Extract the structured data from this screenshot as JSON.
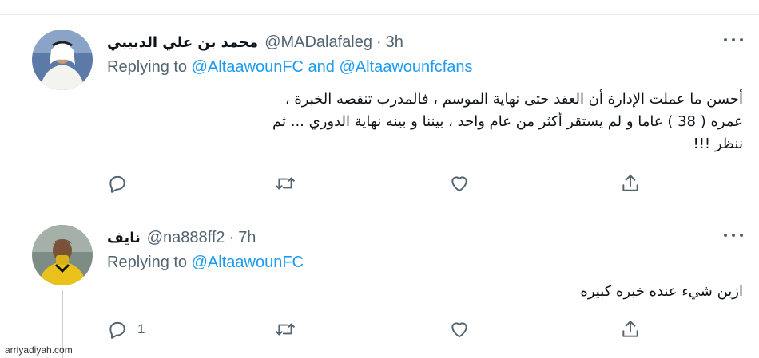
{
  "tweets": [
    {
      "author_name": "محمد بن علي الدبيبي",
      "handle": "@MADalafaleg",
      "separator": "·",
      "time": "3h",
      "replying_prefix": "Replying to ",
      "replying_to": "@AltaawounFC and @Altaawounfcfans",
      "text_lines": [
        "أحسن ما عملت الإدارة أن العقد حتى نهاية الموسم ، فالمدرب تنقصه الخبرة ،",
        "عمره ( 38 ) عاما و لم يستقر أكثر من عام واحد ، بيننا و بينه نهاية الدوري ... ثم",
        "ننظر !!!"
      ],
      "reply_count": "",
      "retweet_count": "",
      "like_count": "",
      "avatar_colors": {
        "bg": "#5c7aa8",
        "robe": "#f3f3f0",
        "skin": "#c99a78"
      }
    },
    {
      "author_name": "نايف",
      "handle": "@na888ff2",
      "separator": "·",
      "time": "7h",
      "replying_prefix": "Replying to ",
      "replying_to": "@AltaawounFC",
      "text_lines": [
        "ازين شيء عنده خبره كبيره"
      ],
      "reply_count": "1",
      "retweet_count": "",
      "like_count": "",
      "avatar_colors": {
        "bg": "#7e8c86",
        "shirt": "#e8c21a",
        "skin": "#7a5238"
      }
    }
  ],
  "icons": {
    "more": "more-horizontal-icon",
    "reply": "reply-icon",
    "retweet": "retweet-icon",
    "like": "like-icon",
    "share": "share-icon"
  },
  "colors": {
    "link": "#1d9bf0",
    "secondary_text": "#536471",
    "divider": "#e6ecf0"
  },
  "watermark": "arriyadiyah.com"
}
